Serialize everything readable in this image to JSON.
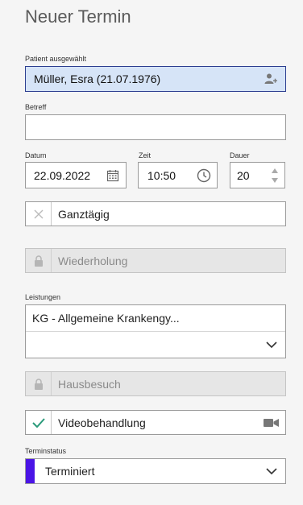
{
  "page": {
    "title": "Neuer Termin"
  },
  "patient": {
    "label": "Patient ausgewählt",
    "value": "Müller, Esra (21.07.1976)"
  },
  "betreff": {
    "label": "Betreff",
    "value": ""
  },
  "datum": {
    "label": "Datum",
    "value": "22.09.2022"
  },
  "zeit": {
    "label": "Zeit",
    "value": "10:50"
  },
  "dauer": {
    "label": "Dauer",
    "value": "20"
  },
  "ganztaegig": {
    "label": "Ganztägig",
    "checked": false
  },
  "wiederholung": {
    "label": "Wiederholung",
    "disabled": true
  },
  "leistungen": {
    "label": "Leistungen",
    "selected": "KG - Allgemeine Krankengy..."
  },
  "hausbesuch": {
    "label": "Hausbesuch",
    "disabled": true
  },
  "videobehandlung": {
    "label": "Videobehandlung",
    "checked": true
  },
  "terminstatus": {
    "label": "Terminstatus",
    "value": "Terminiert",
    "color": "#4a14e6"
  },
  "colors": {
    "accent_border": "#2b3d8f",
    "selected_bg": "#d6e4f7",
    "check": "#2a9a7a"
  }
}
